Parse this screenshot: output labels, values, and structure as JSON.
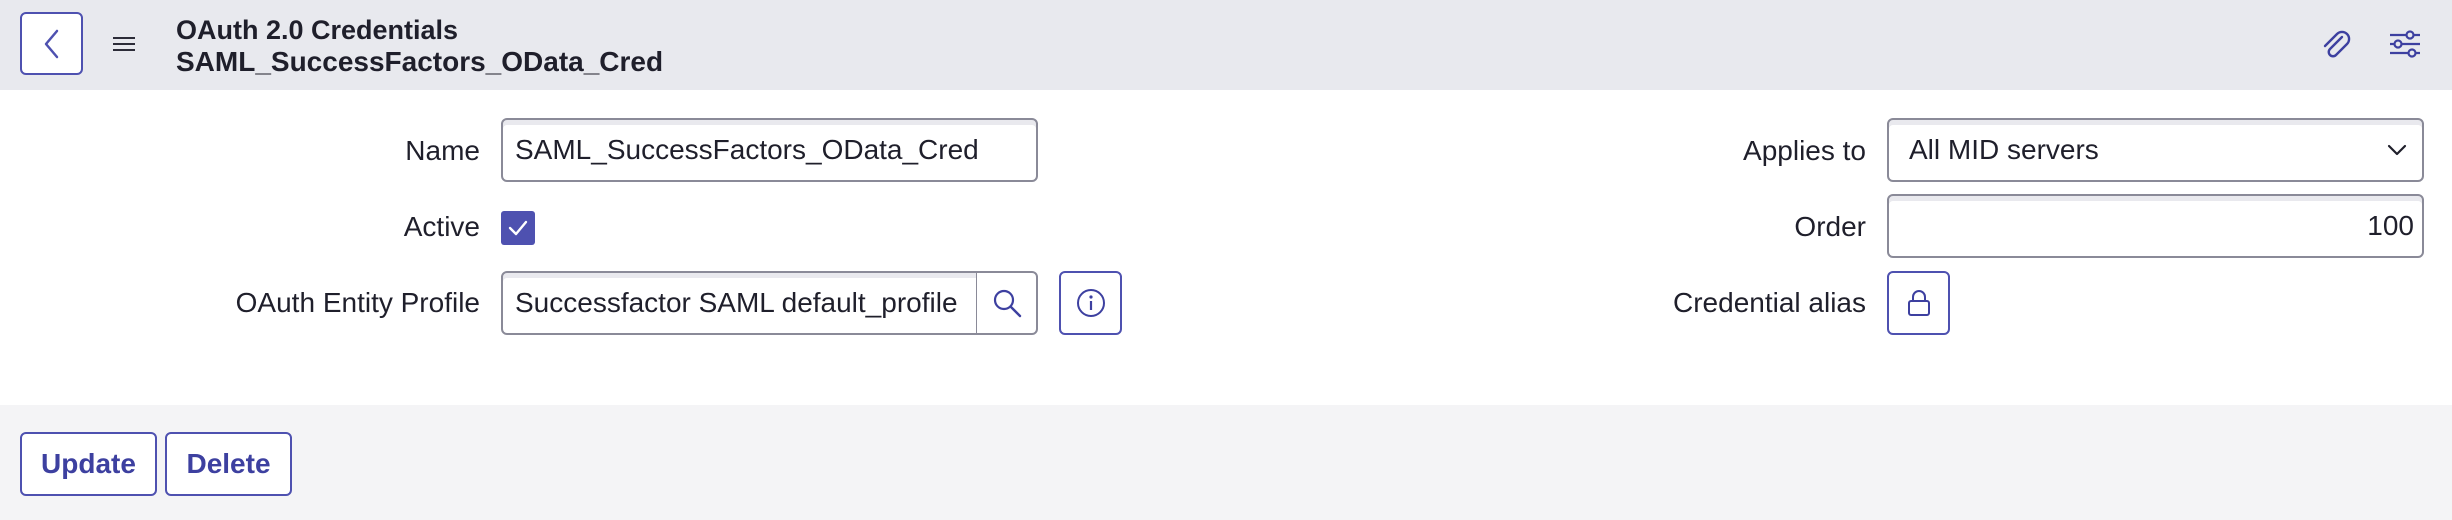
{
  "header": {
    "title": "OAuth 2.0 Credentials",
    "subtitle": "SAML_SuccessFactors_OData_Cred",
    "back_icon": "chevron-left-icon",
    "menu_icon": "hamburger-icon",
    "attach_icon": "paperclip-icon",
    "settings_icon": "sliders-icon"
  },
  "form": {
    "name": {
      "label": "Name",
      "value": "SAML_SuccessFactors_OData_Cred"
    },
    "active": {
      "label": "Active",
      "checked": true
    },
    "oauth_entity_profile": {
      "label": "OAuth Entity Profile",
      "value": "Successfactor SAML default_profile"
    },
    "applies_to": {
      "label": "Applies to",
      "value": "All MID servers"
    },
    "order": {
      "label": "Order",
      "value": "100"
    },
    "credential_alias": {
      "label": "Credential alias"
    }
  },
  "actions": {
    "update_label": "Update",
    "delete_label": "Delete"
  },
  "colors": {
    "accent": "#4e51b0",
    "header_bg": "#e8e9ee",
    "footer_bg": "#f4f4f6"
  }
}
